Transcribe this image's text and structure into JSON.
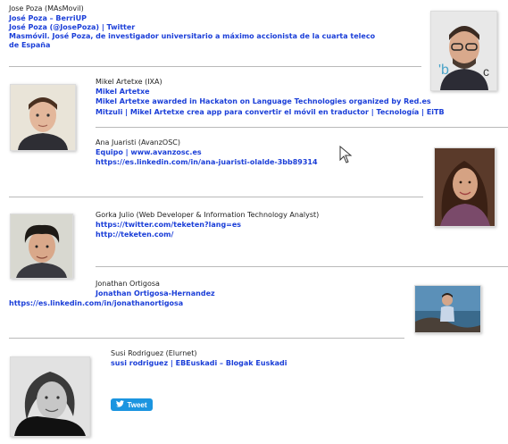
{
  "people": [
    {
      "name": "Jose Poza (MAsMovil)",
      "links": [
        "José Poza – BerriUP",
        "José Poza (@JosePoza) | Twitter",
        "Masmóvil. José Poza, de investigador universitario a máximo accionista de la cuarta teleco",
        "de España"
      ],
      "photo": "man-with-glasses-portrait"
    },
    {
      "name": "Mikel Artetxe (IXA)",
      "links": [
        "Mikel Artetxe",
        "Mikel Artetxe awarded in Hackaton on Language Technologies organized by Red.es",
        "Mitzuli | Mikel Artetxe crea app para convertir el móvil en traductor | Tecnología | EiTB"
      ],
      "photo": "young-man-portrait"
    },
    {
      "name": "Ana Juaristi (AvanzOSC)",
      "links": [
        "Equipo | www.avanzosc.es",
        "https://es.linkedin.com/in/ana-juaristi-olalde-3bb89314"
      ],
      "photo": "woman-curly-hair-portrait"
    },
    {
      "name": "Gorka Julio (Web Developer & Information Technology Analyst)",
      "links": [
        "https://twitter.com/teketen?lang=es",
        "http://teketen.com/"
      ],
      "photo": "man-curly-hair-portrait"
    },
    {
      "name": "Jonathan Ortigosa",
      "links": [
        "Jonathan Ortigosa-Hernandez",
        "https://es.linkedin.com/in/jonathanortigosa"
      ],
      "photo": "man-by-sea-photo"
    },
    {
      "name": "Susi Rodriguez (Elurnet)",
      "links": [
        "susi rodriguez | EBEuskadi – Blogak Euskadi"
      ],
      "photo": "woman-bw-portrait"
    }
  ],
  "share": {
    "tweet_label": "Tweet",
    "icon": "twitter-bird-icon"
  },
  "colors": {
    "link": "#1a3ed8",
    "text": "#222222",
    "rule": "#b9b9b9",
    "tweet": "#1b95e0"
  }
}
